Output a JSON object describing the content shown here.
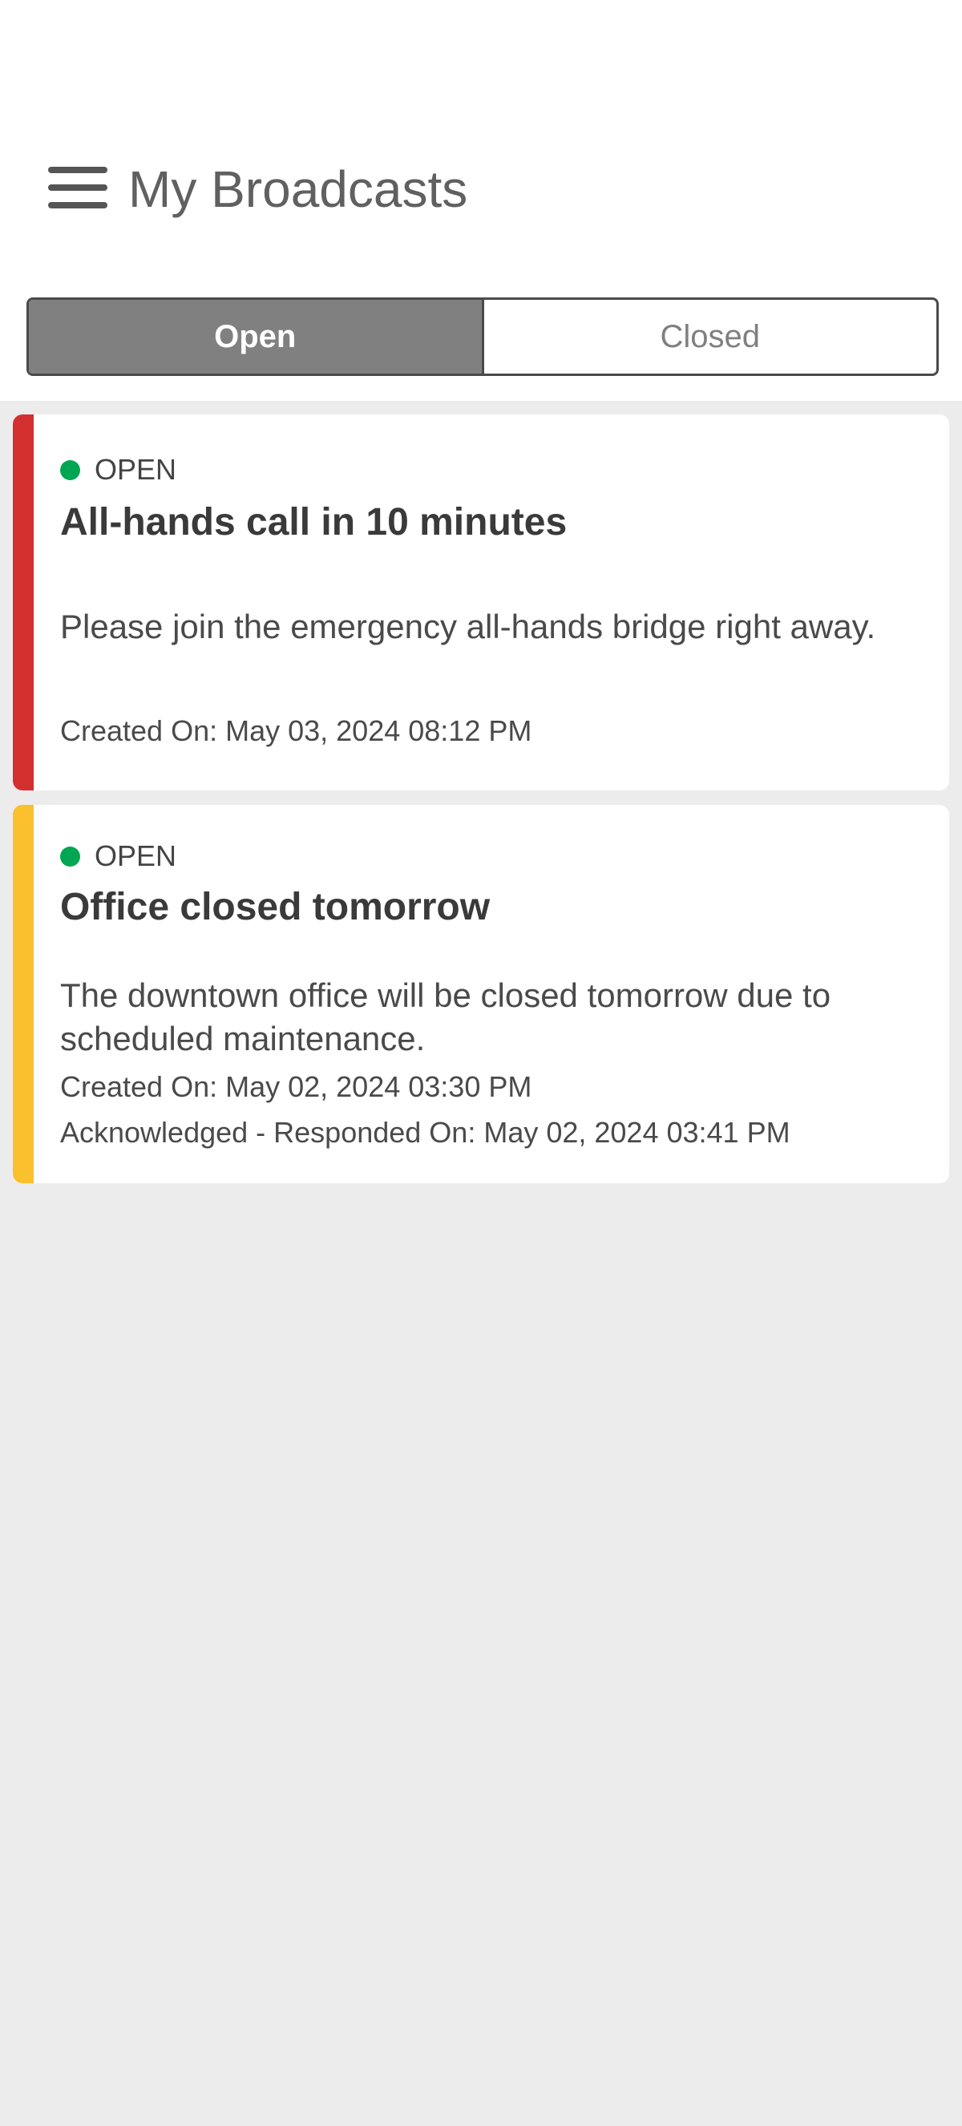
{
  "header": {
    "title": "My Broadcasts",
    "menu_icon": "hamburger-menu-icon"
  },
  "tabs": [
    {
      "label": "Open",
      "active": true
    },
    {
      "label": "Closed",
      "active": false
    }
  ],
  "colors": {
    "open_status_dot": "#00a651",
    "priority_high": "#d32f2f",
    "priority_medium": "#fbc02d",
    "active_tab": "#808080"
  },
  "broadcasts": [
    {
      "status": "OPEN",
      "title": "All-hands call in 10 minutes",
      "message": "Please join the emergency all-hands bridge right away.",
      "created": "Created On: May 03, 2024 08:12 PM",
      "priority_color": "#d32f2f"
    },
    {
      "status": "OPEN",
      "title": "Office closed tomorrow",
      "message": "The downtown office will be closed tomorrow due to scheduled maintenance.",
      "created": "Created On: May 02, 2024 03:30 PM",
      "acknowledged": "Acknowledged - Responded On: May 02, 2024 03:41 PM",
      "priority_color": "#fbc02d"
    }
  ]
}
